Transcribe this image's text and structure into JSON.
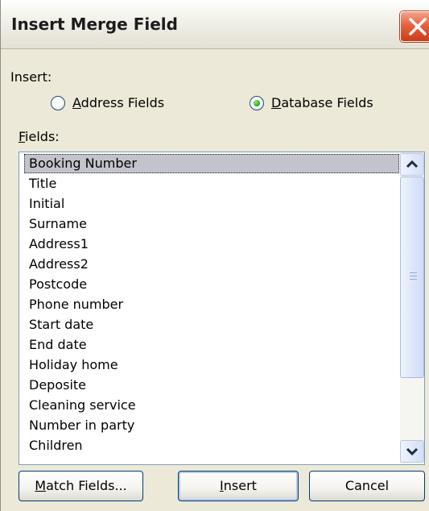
{
  "dialog": {
    "title": "Insert Merge Field",
    "close_icon": "close-icon"
  },
  "insert_group": {
    "label": "Insert:",
    "options": [
      {
        "label_first": "A",
        "label_rest": "ddress Fields",
        "selected": false
      },
      {
        "label_first": "D",
        "label_rest": "atabase Fields",
        "selected": true
      }
    ]
  },
  "fields": {
    "label_first": "F",
    "label_rest": "ields:",
    "items": [
      "Booking Number",
      "Title",
      "Initial",
      "Surname",
      "Address1",
      "Address2",
      "Postcode",
      "Phone number",
      "Start date",
      "End date",
      "Holiday home",
      "Deposite",
      "Cleaning service",
      "Number in party",
      "Children"
    ],
    "selected_item": "Booking Number"
  },
  "buttons": {
    "match_first": "M",
    "match_rest": "atch Fields...",
    "insert_first": "I",
    "insert_rest": "nsert",
    "cancel": "Cancel"
  },
  "colors": {
    "dialog_bg": "#ece9d8",
    "selection_bg": "#c3c3cc",
    "close_red": "#e4633f",
    "radio_green": "#3bb12c"
  }
}
